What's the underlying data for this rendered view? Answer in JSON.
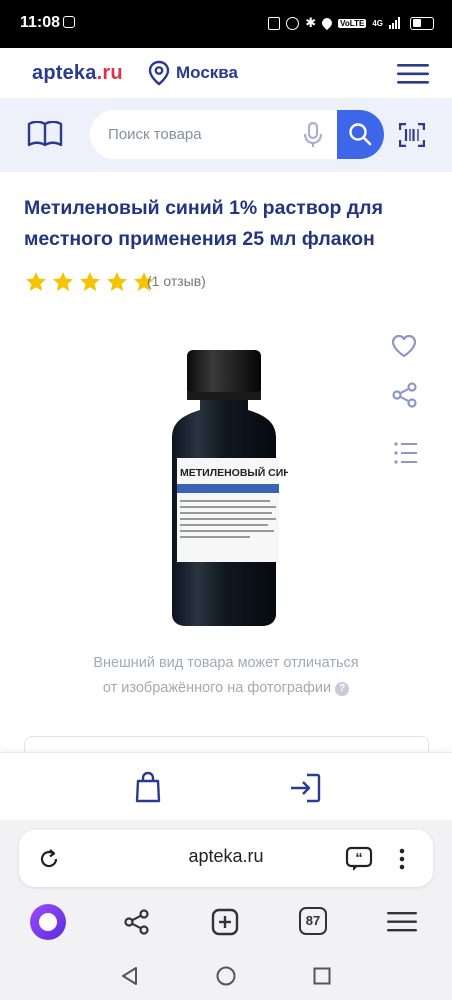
{
  "status_bar": {
    "time": "11:08",
    "network": "4G",
    "volte": "VoLTE"
  },
  "header": {
    "logo_main": "apteka",
    "logo_tld": ".ru",
    "city": "Москва"
  },
  "search": {
    "placeholder": "Поиск товара"
  },
  "product": {
    "title": "Метиленовый синий 1% раствор для местного применения 25 мл флакон",
    "rating": 5,
    "reviews_label": "(1 отзыв)",
    "bottle_label": "МЕТИЛЕНОВЫЙ СИНИЙ",
    "photo_note_line1": "Внешний вид товара может отличаться",
    "photo_note_line2": "от изображённого на фотографии"
  },
  "browser": {
    "url": "apteka.ru",
    "tab_count": "87"
  },
  "colors": {
    "brand": "#2a3b8f",
    "accent": "#3e66e8",
    "logo_red": "#e0314b",
    "star": "#f5c400"
  }
}
